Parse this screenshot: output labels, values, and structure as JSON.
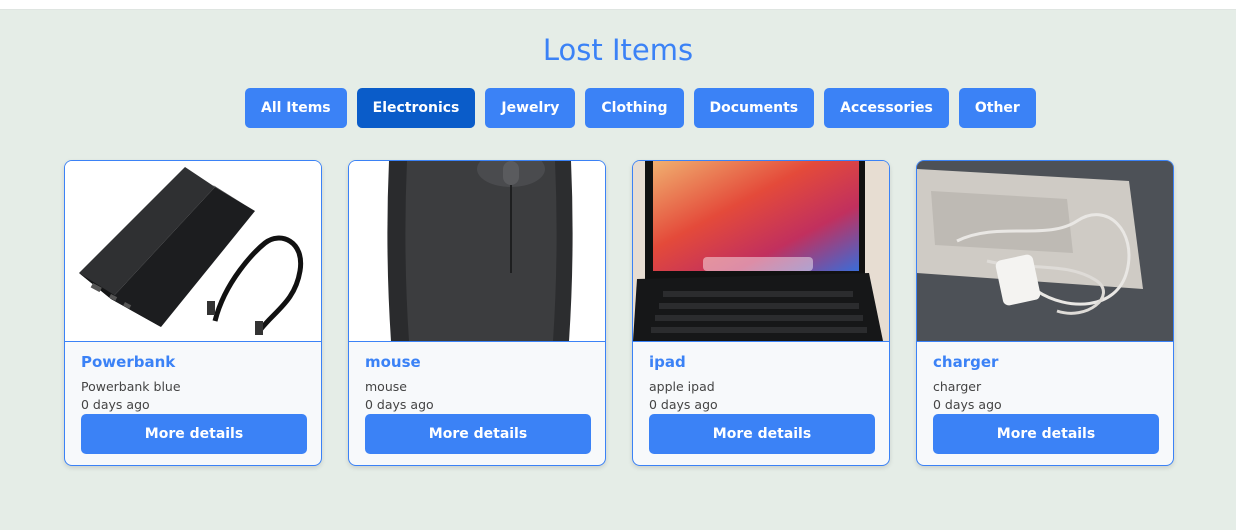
{
  "page": {
    "title": "Lost Items"
  },
  "filters": [
    {
      "label": "All Items",
      "active": false
    },
    {
      "label": "Electronics",
      "active": true
    },
    {
      "label": "Jewelry",
      "active": false
    },
    {
      "label": "Clothing",
      "active": false
    },
    {
      "label": "Documents",
      "active": false
    },
    {
      "label": "Accessories",
      "active": false
    },
    {
      "label": "Other",
      "active": false
    }
  ],
  "items": [
    {
      "name": "Powerbank",
      "description": "Powerbank blue",
      "time": "0 days ago",
      "button": "More details"
    },
    {
      "name": "mouse",
      "description": "mouse",
      "time": "0 days ago",
      "button": "More details"
    },
    {
      "name": "ipad",
      "description": "apple ipad",
      "time": "0 days ago",
      "button": "More details"
    },
    {
      "name": "charger",
      "description": "charger",
      "time": "0 days ago",
      "button": "More details"
    }
  ],
  "colors": {
    "accent": "#3b82f6",
    "accent_active": "#0a5cc9",
    "background": "#e5ede7"
  }
}
